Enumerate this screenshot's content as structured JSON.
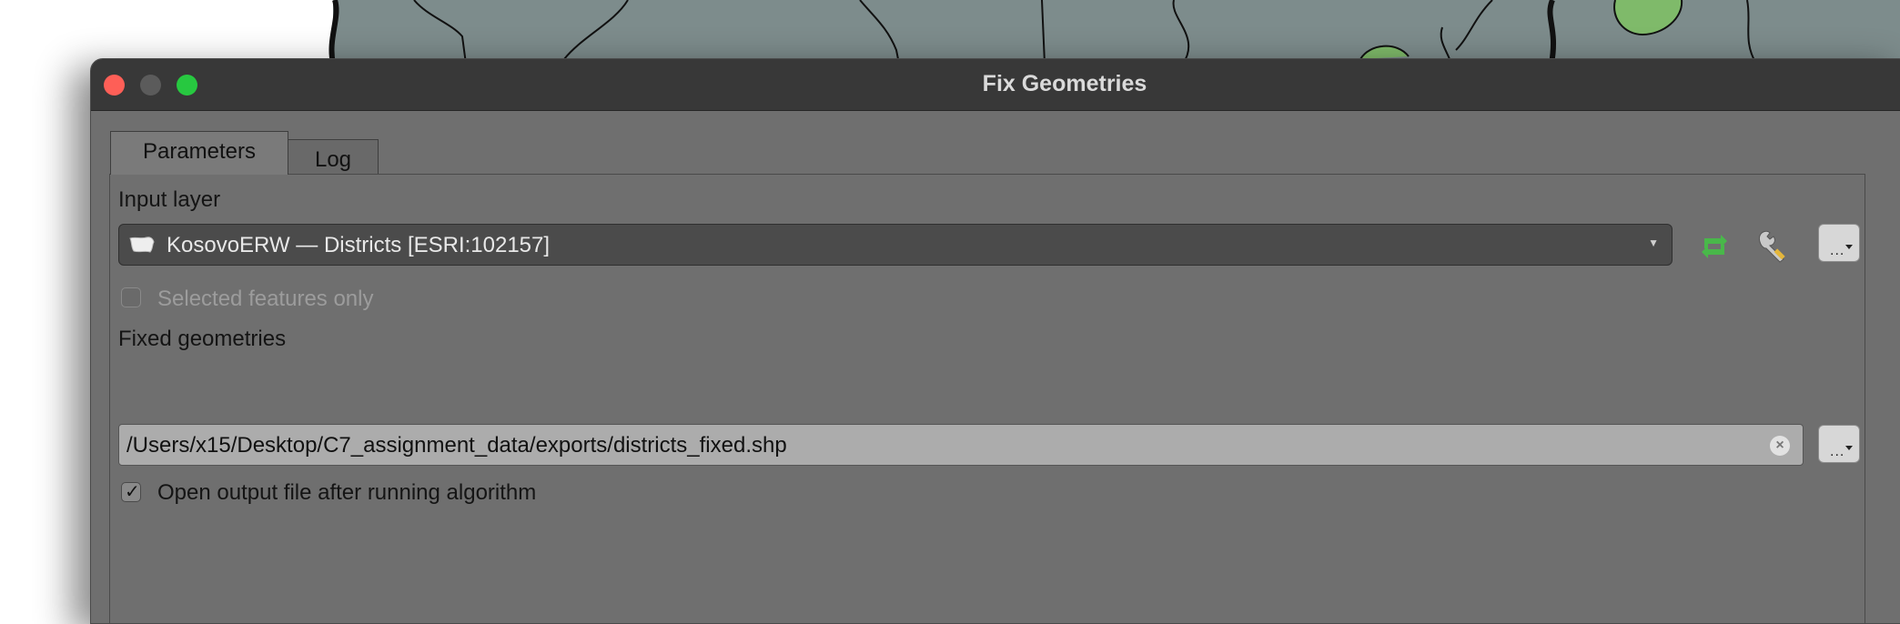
{
  "window": {
    "title": "Fix Geometries"
  },
  "tabs": [
    {
      "label": "Parameters",
      "active": true
    },
    {
      "label": "Log",
      "active": false
    }
  ],
  "input_layer": {
    "label": "Input layer",
    "value": "KosovoERW — Districts [ESRI:102157]",
    "icons": [
      "polygon-layer-icon",
      "dropdown-arrow-icon",
      "iterate-icon",
      "wrench-icon",
      "more-options-icon"
    ]
  },
  "selected_only": {
    "label": "Selected features only",
    "checked": false,
    "enabled": false
  },
  "fixed_geometries": {
    "label": "Fixed geometries",
    "value": "/Users/x15/Desktop/C7_assignment_data/exports/districts_fixed.shp"
  },
  "open_output": {
    "label": "Open output file after running algorithm",
    "checked": true
  },
  "colors": {
    "map_fill": "#7d8c8c",
    "map_feature_green": "#7fba6a",
    "window_bg": "#6f6f6f",
    "titlebar": "#383838",
    "close": "#fe5f57",
    "zoom": "#27c840",
    "iterate_icon": "#49b84a"
  }
}
